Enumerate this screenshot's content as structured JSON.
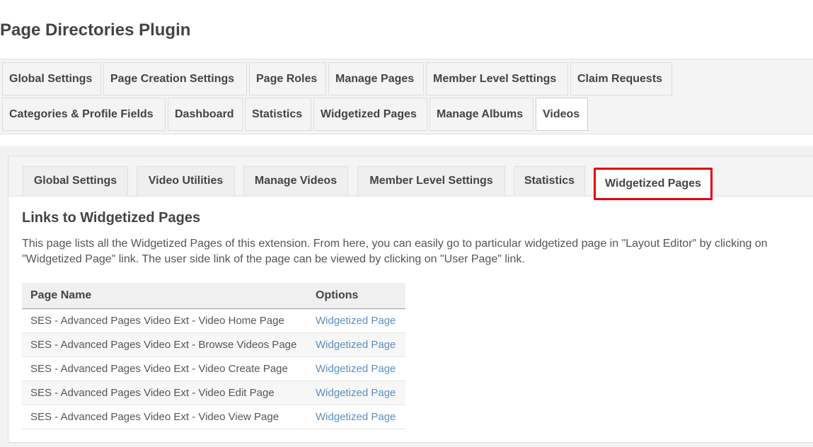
{
  "page": {
    "title": "Page Directories Plugin"
  },
  "top_nav": {
    "tabs": [
      {
        "label": "Global Settings"
      },
      {
        "label": "Page Creation Settings"
      },
      {
        "label": "Page Roles"
      },
      {
        "label": "Manage Pages"
      },
      {
        "label": "Member Level Settings"
      },
      {
        "label": "Claim Requests"
      },
      {
        "label": "Categories & Profile Fields"
      },
      {
        "label": "Dashboard"
      },
      {
        "label": "Statistics"
      },
      {
        "label": "Widgetized Pages"
      },
      {
        "label": "Manage Albums"
      },
      {
        "label": "Videos"
      }
    ],
    "active": "Videos"
  },
  "sub_nav": {
    "tabs": [
      {
        "label": "Global Settings"
      },
      {
        "label": "Video Utilities"
      },
      {
        "label": "Manage Videos"
      },
      {
        "label": "Member Level Settings"
      },
      {
        "label": "Statistics"
      },
      {
        "label": "Widgetized Pages"
      }
    ],
    "active": "Widgetized Pages",
    "highlight_color": "#e3000f"
  },
  "content": {
    "heading": "Links to Widgetized Pages",
    "description": "This page lists all the Widgetized Pages of this extension. From here, you can easily go to particular widgetized page in \"Layout Editor\" by clicking on \"Widgetized Page\" link. The user side link of the page can be viewed by clicking on \"User Page\" link.",
    "table": {
      "headers": [
        "Page Name",
        "Options"
      ],
      "rows": [
        {
          "name": "SES - Advanced Pages Video Ext - Video Home Page",
          "link": "Widgetized Page"
        },
        {
          "name": "SES - Advanced Pages Video Ext - Browse Videos Page",
          "link": "Widgetized Page"
        },
        {
          "name": "SES - Advanced Pages Video Ext - Video Create Page",
          "link": "Widgetized Page"
        },
        {
          "name": "SES - Advanced Pages Video Ext - Video Edit Page",
          "link": "Widgetized Page"
        },
        {
          "name": "SES - Advanced Pages Video Ext - Video View Page",
          "link": "Widgetized Page"
        }
      ]
    }
  },
  "colors": {
    "link": "#5a8fc2",
    "heading": "#444444",
    "text": "#555555"
  }
}
